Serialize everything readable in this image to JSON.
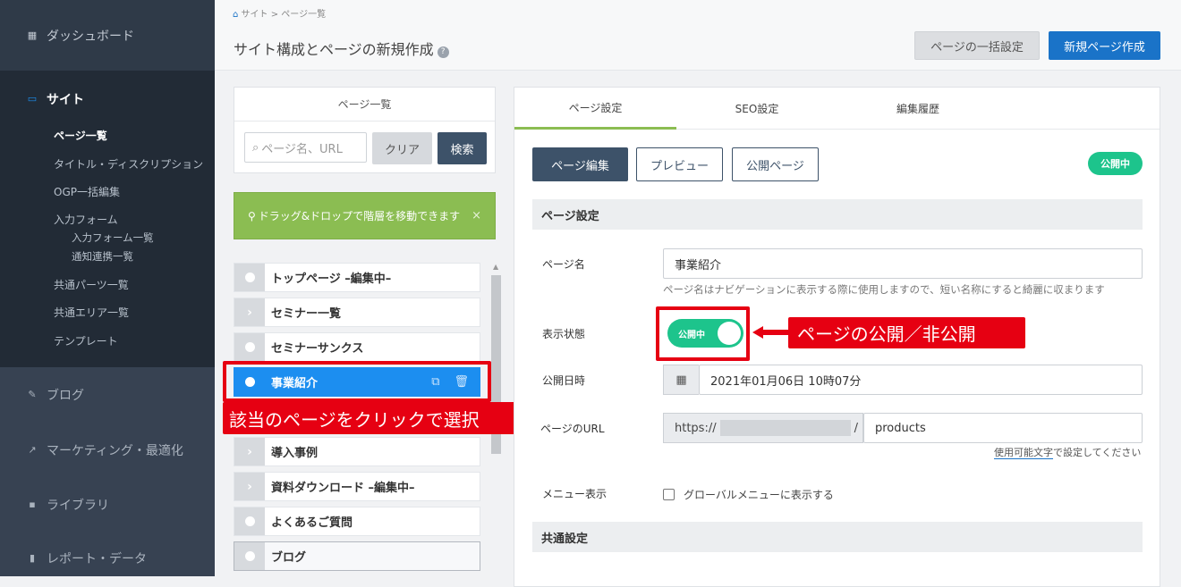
{
  "sidebar": {
    "dashboard": "ダッシュボード",
    "site": "サイト",
    "sub": [
      "ページ一覧",
      "タイトル・ディスクリプション",
      "OGP一括編集",
      "入力フォーム"
    ],
    "sub_form": [
      "入力フォーム一覧",
      "通知連携一覧"
    ],
    "sub2": [
      "共通パーツ一覧",
      "共通エリア一覧",
      "テンプレート"
    ],
    "blog": "ブログ",
    "marketing": "マーケティング・最適化",
    "library": "ライブラリ",
    "report": "レポート・データ"
  },
  "header": {
    "breadcrumb": "サイト  >  ページ一覧",
    "title": "サイト構成とページの新規作成",
    "help": "?",
    "bulk_button": "ページの一括設定",
    "new_button": "新規ページ作成"
  },
  "left_panel": {
    "title": "ページ一覧",
    "search_placeholder": "ページ名、URL",
    "clear": "クリア",
    "search": "検索",
    "dnd_note": "ドラッグ&ドロップで階層を移動できます",
    "close": "×"
  },
  "tree": [
    {
      "label": "トップページ –編集中–",
      "type": "dot"
    },
    {
      "label": "セミナー一覧",
      "type": "chev"
    },
    {
      "label": "セミナーサンクス",
      "type": "dot"
    },
    {
      "label": "事業紹介",
      "type": "dot"
    },
    {
      "label": "導入事例",
      "type": "chev"
    },
    {
      "label": "資料ダウンロード –編集中–",
      "type": "chev"
    },
    {
      "label": "よくあるご質問",
      "type": "dot"
    },
    {
      "label": "ブログ",
      "type": "dot"
    }
  ],
  "annotations": {
    "select_page": "該当のページをクリックで選択",
    "publish_toggle": "ページの公開／非公開"
  },
  "right_panel": {
    "tabs": [
      "ページ設定",
      "SEO設定",
      "編集履歴"
    ],
    "edit": "ページ編集",
    "preview": "プレビュー",
    "public_page": "公開ページ",
    "status_badge": "公開中",
    "section_page": "ページ設定",
    "label_name": "ページ名",
    "value_name": "事業紹介",
    "help_name": "ページ名はナビゲーションに表示する際に使用しますので、短い名称にすると綺麗に収まります",
    "label_status": "表示状態",
    "toggle_label": "公開中",
    "label_date": "公開日時",
    "value_date": "2021年01月06日 10時07分",
    "label_url": "ページのURL",
    "url_prefix": "https://",
    "url_slash": "/",
    "url_value": "products",
    "url_help_link": "使用可能文字",
    "url_help_rest": "で設定してください",
    "label_menu": "メニュー表示",
    "menu_checkbox": "グローバルメニューに表示する",
    "section_common": "共通設定"
  },
  "colors": {
    "accent_blue": "#1a73c8",
    "green": "#1dc48c",
    "annotation_red": "#e60012",
    "tab_underline": "#8bbd52"
  }
}
